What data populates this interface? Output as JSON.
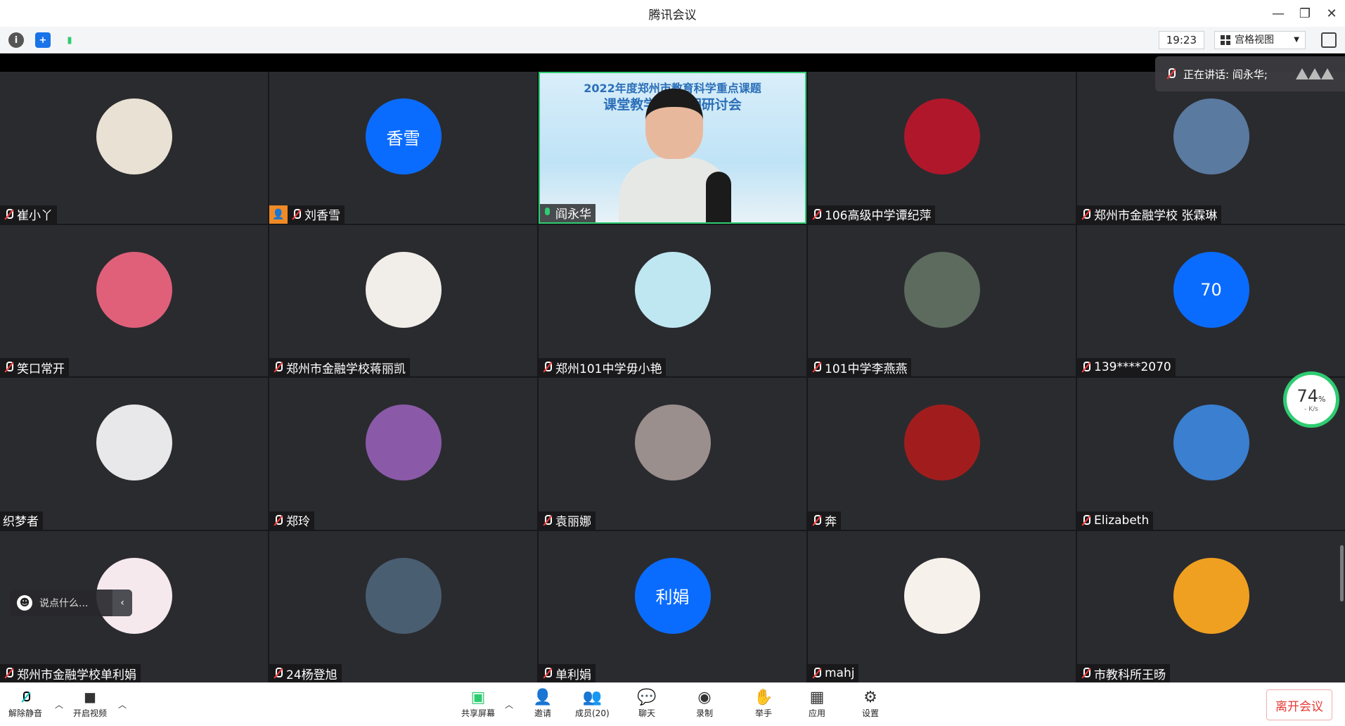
{
  "window": {
    "title": "腾讯会议"
  },
  "toolbar": {
    "time": "19:23",
    "view_label": "宫格视图"
  },
  "speaking": {
    "label": "正在讲话: 阎永华;"
  },
  "network": {
    "percent": "74",
    "percent_unit": "%",
    "speed": "- K/s"
  },
  "chat": {
    "placeholder": "说点什么..."
  },
  "video": {
    "banner_line1": "2022年度郑州市教育科学重点课题",
    "banner_line2": "课堂教学研        中期研讨会"
  },
  "tiles": [
    {
      "name": "崔小丫",
      "avatar_text": "",
      "avatar_color": "#e9e1d4",
      "muted": true
    },
    {
      "name": "刘香雪",
      "avatar_text": "香雪",
      "avatar_color": "#0a6cff",
      "muted": true
    },
    {
      "name": "阎永华",
      "avatar_text": "",
      "avatar_color": "",
      "muted": false
    },
    {
      "name": "106高级中学谭纪萍",
      "avatar_text": "",
      "avatar_color": "#b0172b",
      "muted": true
    },
    {
      "name": "郑州市金融学校 张霖琳",
      "avatar_text": "",
      "avatar_color": "#5a7aa0",
      "muted": true
    },
    {
      "name": "笑口常开",
      "avatar_text": "",
      "avatar_color": "#e0607a",
      "muted": true
    },
    {
      "name": "郑州市金融学校蒋丽凯",
      "avatar_text": "",
      "avatar_color": "#f1ede8",
      "muted": true
    },
    {
      "name": "郑州101中学毋小艳",
      "avatar_text": "",
      "avatar_color": "#bfe7f2",
      "muted": true
    },
    {
      "name": "101中学李燕燕",
      "avatar_text": "",
      "avatar_color": "#5c6b5e",
      "muted": true
    },
    {
      "name": "139****2070",
      "avatar_text": "70",
      "avatar_color": "#0a6cff",
      "muted": true
    },
    {
      "name": "织梦者",
      "avatar_text": "",
      "avatar_color": "#e8e8ea",
      "muted": false
    },
    {
      "name": "郑玲",
      "avatar_text": "",
      "avatar_color": "#8a5aa8",
      "muted": true
    },
    {
      "name": "袁丽娜",
      "avatar_text": "",
      "avatar_color": "#9a8f8c",
      "muted": true
    },
    {
      "name": "奔",
      "avatar_text": "",
      "avatar_color": "#a11d1d",
      "muted": true
    },
    {
      "name": "Elizabeth",
      "avatar_text": "",
      "avatar_color": "#3a7fd0",
      "muted": true
    },
    {
      "name": "郑州市金融学校单利娟",
      "avatar_text": "",
      "avatar_color": "#f6e9ee",
      "muted": true
    },
    {
      "name": "24杨登旭",
      "avatar_text": "",
      "avatar_color": "#4a5e72",
      "muted": true
    },
    {
      "name": "单利娟",
      "avatar_text": "利娟",
      "avatar_color": "#0a6cff",
      "muted": true
    },
    {
      "name": "mahj",
      "avatar_text": "",
      "avatar_color": "#f7f1ec",
      "muted": true
    },
    {
      "name": "市教科所王旸",
      "avatar_text": "",
      "avatar_color": "#f0a020",
      "muted": true
    }
  ],
  "bottom": {
    "unmute": "解除静音",
    "start_video": "开启视频",
    "share": "共享屏幕",
    "invite": "邀请",
    "members": "成员(20)",
    "chat": "聊天",
    "record": "录制",
    "raise_hand": "举手",
    "apps": "应用",
    "settings": "设置",
    "leave": "离开会议"
  }
}
